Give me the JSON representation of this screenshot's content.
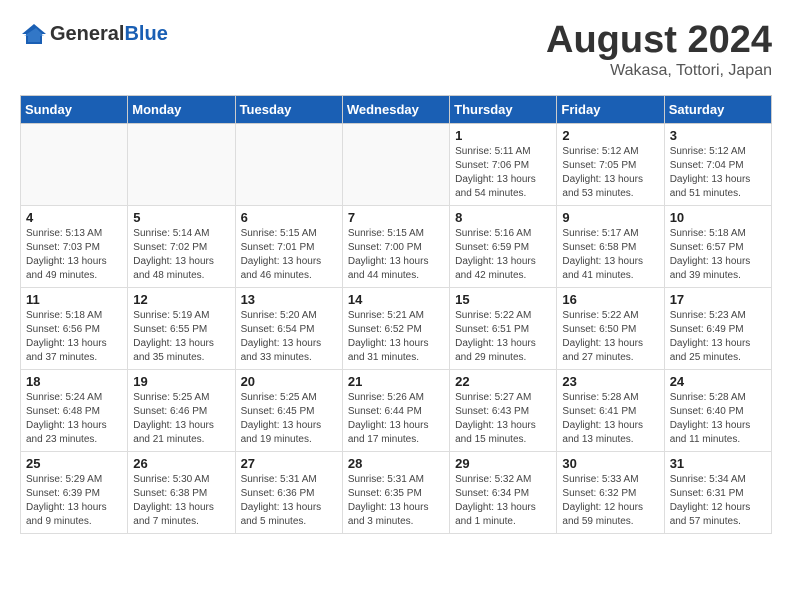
{
  "header": {
    "logo_general": "General",
    "logo_blue": "Blue",
    "month": "August 2024",
    "location": "Wakasa, Tottori, Japan"
  },
  "weekdays": [
    "Sunday",
    "Monday",
    "Tuesday",
    "Wednesday",
    "Thursday",
    "Friday",
    "Saturday"
  ],
  "weeks": [
    [
      {
        "day": "",
        "info": ""
      },
      {
        "day": "",
        "info": ""
      },
      {
        "day": "",
        "info": ""
      },
      {
        "day": "",
        "info": ""
      },
      {
        "day": "1",
        "info": "Sunrise: 5:11 AM\nSunset: 7:06 PM\nDaylight: 13 hours\nand 54 minutes."
      },
      {
        "day": "2",
        "info": "Sunrise: 5:12 AM\nSunset: 7:05 PM\nDaylight: 13 hours\nand 53 minutes."
      },
      {
        "day": "3",
        "info": "Sunrise: 5:12 AM\nSunset: 7:04 PM\nDaylight: 13 hours\nand 51 minutes."
      }
    ],
    [
      {
        "day": "4",
        "info": "Sunrise: 5:13 AM\nSunset: 7:03 PM\nDaylight: 13 hours\nand 49 minutes."
      },
      {
        "day": "5",
        "info": "Sunrise: 5:14 AM\nSunset: 7:02 PM\nDaylight: 13 hours\nand 48 minutes."
      },
      {
        "day": "6",
        "info": "Sunrise: 5:15 AM\nSunset: 7:01 PM\nDaylight: 13 hours\nand 46 minutes."
      },
      {
        "day": "7",
        "info": "Sunrise: 5:15 AM\nSunset: 7:00 PM\nDaylight: 13 hours\nand 44 minutes."
      },
      {
        "day": "8",
        "info": "Sunrise: 5:16 AM\nSunset: 6:59 PM\nDaylight: 13 hours\nand 42 minutes."
      },
      {
        "day": "9",
        "info": "Sunrise: 5:17 AM\nSunset: 6:58 PM\nDaylight: 13 hours\nand 41 minutes."
      },
      {
        "day": "10",
        "info": "Sunrise: 5:18 AM\nSunset: 6:57 PM\nDaylight: 13 hours\nand 39 minutes."
      }
    ],
    [
      {
        "day": "11",
        "info": "Sunrise: 5:18 AM\nSunset: 6:56 PM\nDaylight: 13 hours\nand 37 minutes."
      },
      {
        "day": "12",
        "info": "Sunrise: 5:19 AM\nSunset: 6:55 PM\nDaylight: 13 hours\nand 35 minutes."
      },
      {
        "day": "13",
        "info": "Sunrise: 5:20 AM\nSunset: 6:54 PM\nDaylight: 13 hours\nand 33 minutes."
      },
      {
        "day": "14",
        "info": "Sunrise: 5:21 AM\nSunset: 6:52 PM\nDaylight: 13 hours\nand 31 minutes."
      },
      {
        "day": "15",
        "info": "Sunrise: 5:22 AM\nSunset: 6:51 PM\nDaylight: 13 hours\nand 29 minutes."
      },
      {
        "day": "16",
        "info": "Sunrise: 5:22 AM\nSunset: 6:50 PM\nDaylight: 13 hours\nand 27 minutes."
      },
      {
        "day": "17",
        "info": "Sunrise: 5:23 AM\nSunset: 6:49 PM\nDaylight: 13 hours\nand 25 minutes."
      }
    ],
    [
      {
        "day": "18",
        "info": "Sunrise: 5:24 AM\nSunset: 6:48 PM\nDaylight: 13 hours\nand 23 minutes."
      },
      {
        "day": "19",
        "info": "Sunrise: 5:25 AM\nSunset: 6:46 PM\nDaylight: 13 hours\nand 21 minutes."
      },
      {
        "day": "20",
        "info": "Sunrise: 5:25 AM\nSunset: 6:45 PM\nDaylight: 13 hours\nand 19 minutes."
      },
      {
        "day": "21",
        "info": "Sunrise: 5:26 AM\nSunset: 6:44 PM\nDaylight: 13 hours\nand 17 minutes."
      },
      {
        "day": "22",
        "info": "Sunrise: 5:27 AM\nSunset: 6:43 PM\nDaylight: 13 hours\nand 15 minutes."
      },
      {
        "day": "23",
        "info": "Sunrise: 5:28 AM\nSunset: 6:41 PM\nDaylight: 13 hours\nand 13 minutes."
      },
      {
        "day": "24",
        "info": "Sunrise: 5:28 AM\nSunset: 6:40 PM\nDaylight: 13 hours\nand 11 minutes."
      }
    ],
    [
      {
        "day": "25",
        "info": "Sunrise: 5:29 AM\nSunset: 6:39 PM\nDaylight: 13 hours\nand 9 minutes."
      },
      {
        "day": "26",
        "info": "Sunrise: 5:30 AM\nSunset: 6:38 PM\nDaylight: 13 hours\nand 7 minutes."
      },
      {
        "day": "27",
        "info": "Sunrise: 5:31 AM\nSunset: 6:36 PM\nDaylight: 13 hours\nand 5 minutes."
      },
      {
        "day": "28",
        "info": "Sunrise: 5:31 AM\nSunset: 6:35 PM\nDaylight: 13 hours\nand 3 minutes."
      },
      {
        "day": "29",
        "info": "Sunrise: 5:32 AM\nSunset: 6:34 PM\nDaylight: 13 hours\nand 1 minute."
      },
      {
        "day": "30",
        "info": "Sunrise: 5:33 AM\nSunset: 6:32 PM\nDaylight: 12 hours\nand 59 minutes."
      },
      {
        "day": "31",
        "info": "Sunrise: 5:34 AM\nSunset: 6:31 PM\nDaylight: 12 hours\nand 57 minutes."
      }
    ]
  ]
}
